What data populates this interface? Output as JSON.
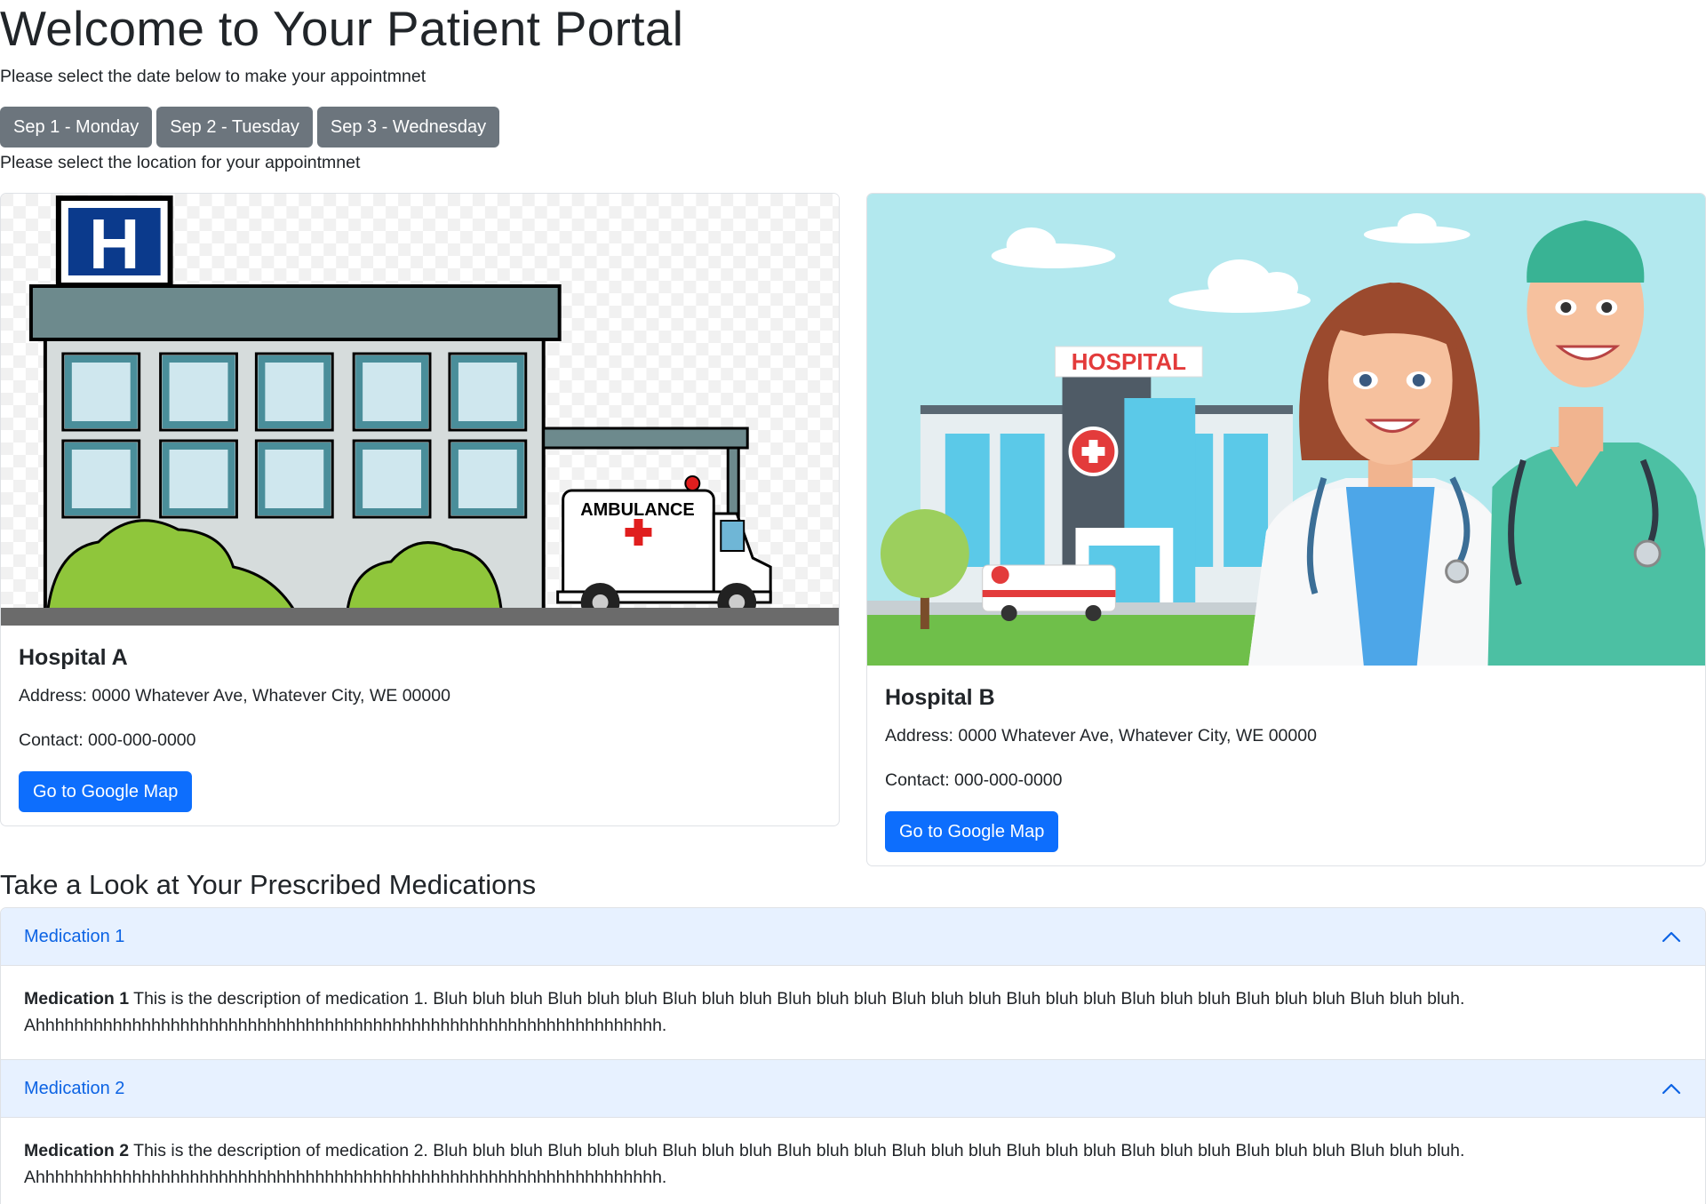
{
  "header": {
    "title": "Welcome to Your Patient Portal",
    "date_instruction": "Please select the date below to make your appointmnet",
    "location_instruction": "Please select the location for your appointmnet"
  },
  "dates": [
    "Sep 1 - Monday",
    "Sep 2 - Tuesday",
    "Sep 3 - Wednesday"
  ],
  "hospitals": [
    {
      "name": "Hospital A",
      "address": "Address: 0000 Whatever Ave, Whatever City, WE 00000",
      "contact": "Contact: 000-000-0000",
      "button": "Go to Google Map",
      "image_label": "AMBULANCE"
    },
    {
      "name": "Hospital B",
      "address": "Address: 0000 Whatever Ave, Whatever City, WE 00000",
      "contact": "Contact: 000-000-0000",
      "button": "Go to Google Map",
      "image_label": "HOSPITAL"
    }
  ],
  "medications": {
    "title": "Take a Look at Your Prescribed Medications",
    "items": [
      {
        "header": "Medication 1",
        "bold": "Medication 1",
        "text": " This is the description of medication 1. Bluh bluh bluh Bluh bluh bluh Bluh bluh bluh Bluh bluh bluh Bluh bluh bluh Bluh bluh bluh Bluh bluh bluh Bluh bluh bluh Bluh bluh bluh.",
        "text2": "Ahhhhhhhhhhhhhhhhhhhhhhhhhhhhhhhhhhhhhhhhhhhhhhhhhhhhhhhhhhhhhhhhh."
      },
      {
        "header": "Medication 2",
        "bold": "Medication 2",
        "text": " This is the description of medication 2. Bluh bluh bluh Bluh bluh bluh Bluh bluh bluh Bluh bluh bluh Bluh bluh bluh Bluh bluh bluh Bluh bluh bluh Bluh bluh bluh Bluh bluh bluh.",
        "text2": "Ahhhhhhhhhhhhhhhhhhhhhhhhhhhhhhhhhhhhhhhhhhhhhhhhhhhhhhhhhhhhhhhhh."
      }
    ]
  },
  "colors": {
    "primary": "#0d6efd",
    "secondary": "#6c757d",
    "accordion_active_bg": "#e7f1ff",
    "accordion_active_text": "#0c63e4"
  },
  "icons": {
    "accordion_toggle": "chevron-up-icon"
  }
}
